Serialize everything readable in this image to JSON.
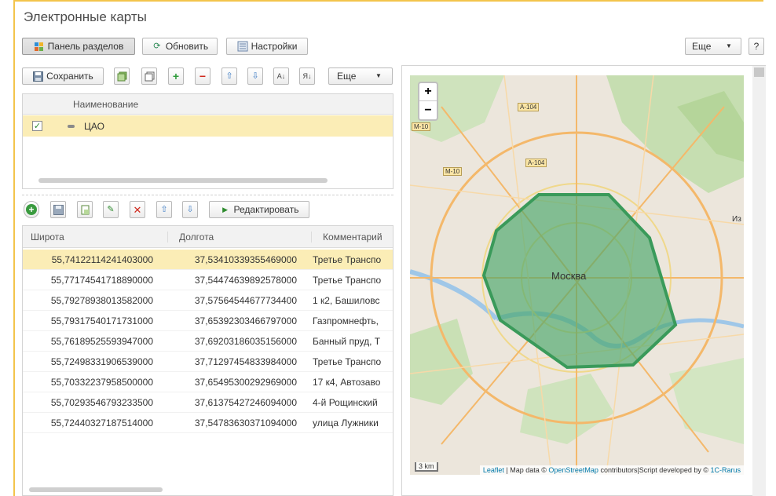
{
  "title": "Электронные карты",
  "top_toolbar": {
    "sections_panel": "Панель разделов",
    "refresh": "Обновить",
    "settings": "Настройки",
    "more": "Еще",
    "help": "?"
  },
  "list_toolbar": {
    "save": "Сохранить",
    "more": "Еще"
  },
  "areas_grid": {
    "column": "Наименование",
    "rows": [
      {
        "name": "ЦАО",
        "checked": true
      }
    ]
  },
  "points_toolbar": {
    "edit": "Редактировать"
  },
  "points_grid": {
    "columns": {
      "lat": "Широта",
      "lon": "Долгота",
      "comment": "Комментарий"
    },
    "rows": [
      {
        "lat": "55,74122114241403000",
        "lon": "37,53410339355469000",
        "comment": "Третье Транспо"
      },
      {
        "lat": "55,77174541718890000",
        "lon": "37,54474639892578000",
        "comment": "Третье Транспо"
      },
      {
        "lat": "55,79278938013582000",
        "lon": "37,57564544677734400",
        "comment": "1 к2, Башиловс"
      },
      {
        "lat": "55,79317540171731000",
        "lon": "37,65392303466797000",
        "comment": "Газпромнефть,"
      },
      {
        "lat": "55,76189525593947000",
        "lon": "37,69203186035156000",
        "comment": "Банный пруд, Т"
      },
      {
        "lat": "55,72498331906539000",
        "lon": "37,71297454833984000",
        "comment": "Третье Транспо"
      },
      {
        "lat": "55,70332237958500000",
        "lon": "37,65495300292969000",
        "comment": "17 к4, Автозаво"
      },
      {
        "lat": "55,70293546793233500",
        "lon": "37,61375427246094000",
        "comment": "4-й Рощинский"
      },
      {
        "lat": "55,72440327187514000",
        "lon": "37,54783630371094000",
        "comment": "улица Лужники"
      }
    ]
  },
  "map": {
    "zoom_in": "+",
    "zoom_out": "−",
    "city_label": "Москва",
    "road_shields": [
      "А-104",
      "М-10",
      "А-104",
      "М-10"
    ],
    "edge_label": "Из",
    "scale": "3 km",
    "attribution": {
      "leaflet": "Leaflet",
      "pre": " | Map data © ",
      "osm": "OpenStreetMap",
      "mid": " contributors|Script developed by © ",
      "rarus": "1C-Rarus"
    },
    "polygon_color": "#49a86a"
  },
  "colors": {
    "accent": "#f3c44b",
    "selected_row": "#fbedb6"
  }
}
